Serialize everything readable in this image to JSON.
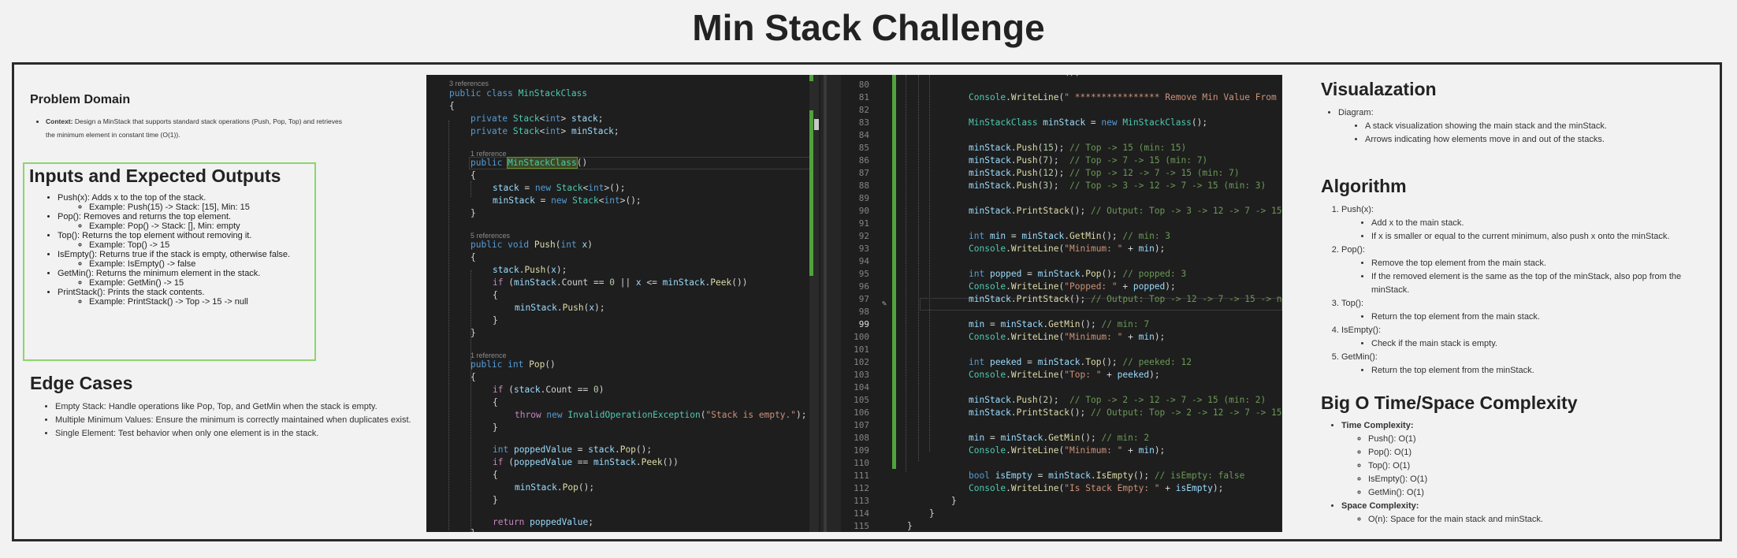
{
  "title": "Min Stack Challenge",
  "problem": {
    "heading": "Problem Domain",
    "context_label": "Context:",
    "context_text": "Design a MinStack that supports standard stack operations (Push, Pop, Top) and retrieves the minimum element in constant time (O(1))."
  },
  "inputs": {
    "heading": "Inputs and Expected Outputs",
    "items": [
      {
        "text": "Push(x): Adds x to the top of the stack.",
        "example": "Example: Push(15) -> Stack: [15], Min: 15"
      },
      {
        "text": "Pop(): Removes and returns the top element.",
        "example": "Example: Pop() -> Stack: [], Min: empty"
      },
      {
        "text": "Top(): Returns the top element without removing it.",
        "example": "Example: Top() -> 15"
      },
      {
        "text": "IsEmpty(): Returns true if the stack is empty, otherwise false.",
        "example": "Example: IsEmpty() -> false"
      },
      {
        "text": "GetMin(): Returns the minimum element in the stack.",
        "example": "Example: GetMin() -> 15"
      },
      {
        "text": "PrintStack(): Prints the stack contents.",
        "example": "Example: PrintStack() -> Top -> 15 -> null"
      }
    ]
  },
  "edge": {
    "heading": "Edge Cases",
    "items": [
      "Empty Stack: Handle operations like Pop, Top, and GetMin when the stack is empty.",
      "Multiple Minimum Values: Ensure the minimum is correctly maintained when duplicates exist.",
      "Single Element: Test behavior when only one element is in the stack."
    ]
  },
  "code_left": {
    "ref_3": "3 references",
    "ref_1a": "1 reference",
    "ref_5": "5 references",
    "ref_1b": "1 reference"
  },
  "code_right": {
    "line_numbers": [
      "80",
      "81",
      "82",
      "83",
      "84",
      "85",
      "86",
      "87",
      "88",
      "89",
      "90",
      "91",
      "92",
      "93",
      "94",
      "95",
      "96",
      "97",
      "98",
      "99",
      "100",
      "101",
      "102",
      "103",
      "104",
      "105",
      "106",
      "107",
      "108",
      "109",
      "110",
      "111",
      "112",
      "113",
      "114",
      "115"
    ]
  },
  "visual": {
    "heading": "Visualazation",
    "diagram_label": "Diagram:",
    "items": [
      "A stack visualization showing the main stack and the minStack.",
      "Arrows indicating how elements move in and out of the stacks."
    ]
  },
  "algorithm": {
    "heading": "Algorithm",
    "steps": [
      {
        "label": "Push(x):",
        "subs": [
          "Add x to the main stack.",
          "If x is smaller or equal to the current minimum, also push x onto the minStack."
        ]
      },
      {
        "label": "Pop():",
        "subs": [
          "Remove the top element from the main stack.",
          "If the removed element is the same as the top of the minStack, also pop from the minStack."
        ]
      },
      {
        "label": "Top():",
        "subs": [
          "Return the top element from the main stack."
        ]
      },
      {
        "label": "IsEmpty():",
        "subs": [
          "Check if the main stack is empty."
        ]
      },
      {
        "label": "GetMin():",
        "subs": [
          "Return the top element from the minStack."
        ]
      }
    ]
  },
  "complexity": {
    "heading": "Big O Time/Space Complexity",
    "time_label": "Time Complexity:",
    "time_items": [
      "Push(): O(1)",
      "Pop(): O(1)",
      "Top(): O(1)",
      "IsEmpty(): O(1)",
      "GetMin(): O(1)"
    ],
    "space_label": "Space Complexity:",
    "space_items": [
      "O(n): Space for the main stack and minStack."
    ]
  }
}
